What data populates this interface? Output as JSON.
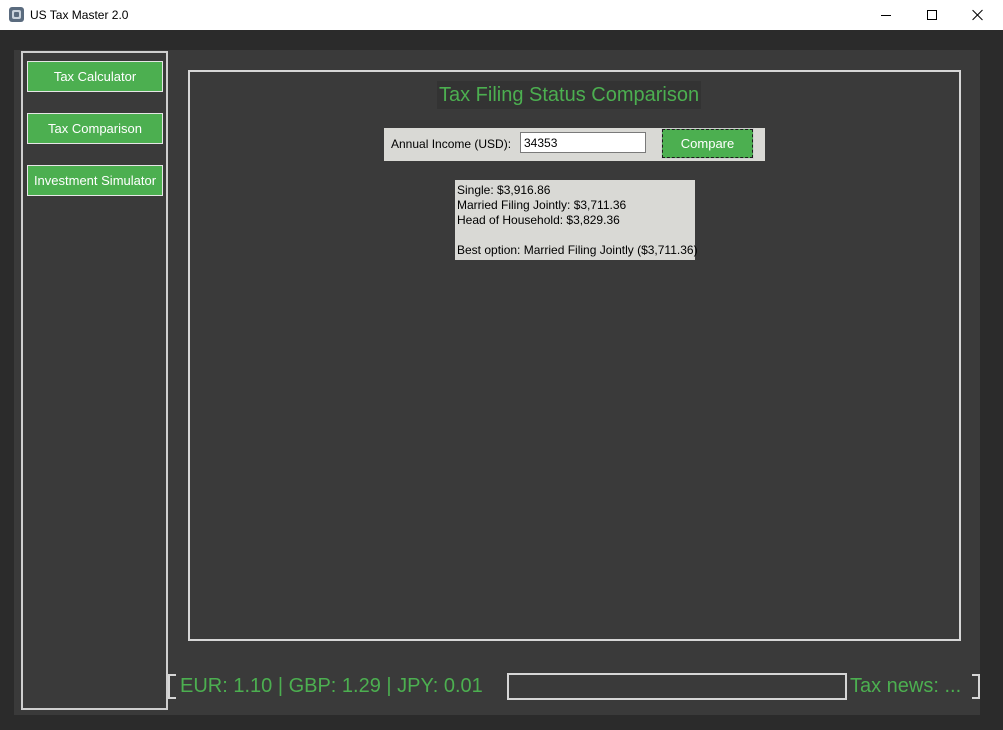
{
  "window": {
    "title": "US Tax Master 2.0"
  },
  "sidebar": {
    "items": [
      {
        "label": "Tax Calculator"
      },
      {
        "label": "Tax Comparison"
      },
      {
        "label": "Investment Simulator"
      }
    ]
  },
  "main": {
    "title": "Tax Filing Status Comparison",
    "income_label": "Annual Income (USD):",
    "income_value": "34353",
    "compare_label": "Compare",
    "results": [
      "Single: $3,916.86",
      "Married Filing Jointly: $3,711.36",
      "Head of Household: $3,829.36",
      "",
      "Best option: Married Filing Jointly ($3,711.36)"
    ]
  },
  "status_bar": {
    "currency": "EUR: 1.10 | GBP: 1.29 | JPY: 0.01",
    "news": "Tax news: ..."
  },
  "colors": {
    "accent": "#4caf50",
    "background": "#2b2b2b",
    "panel": "#3a3a3a"
  }
}
